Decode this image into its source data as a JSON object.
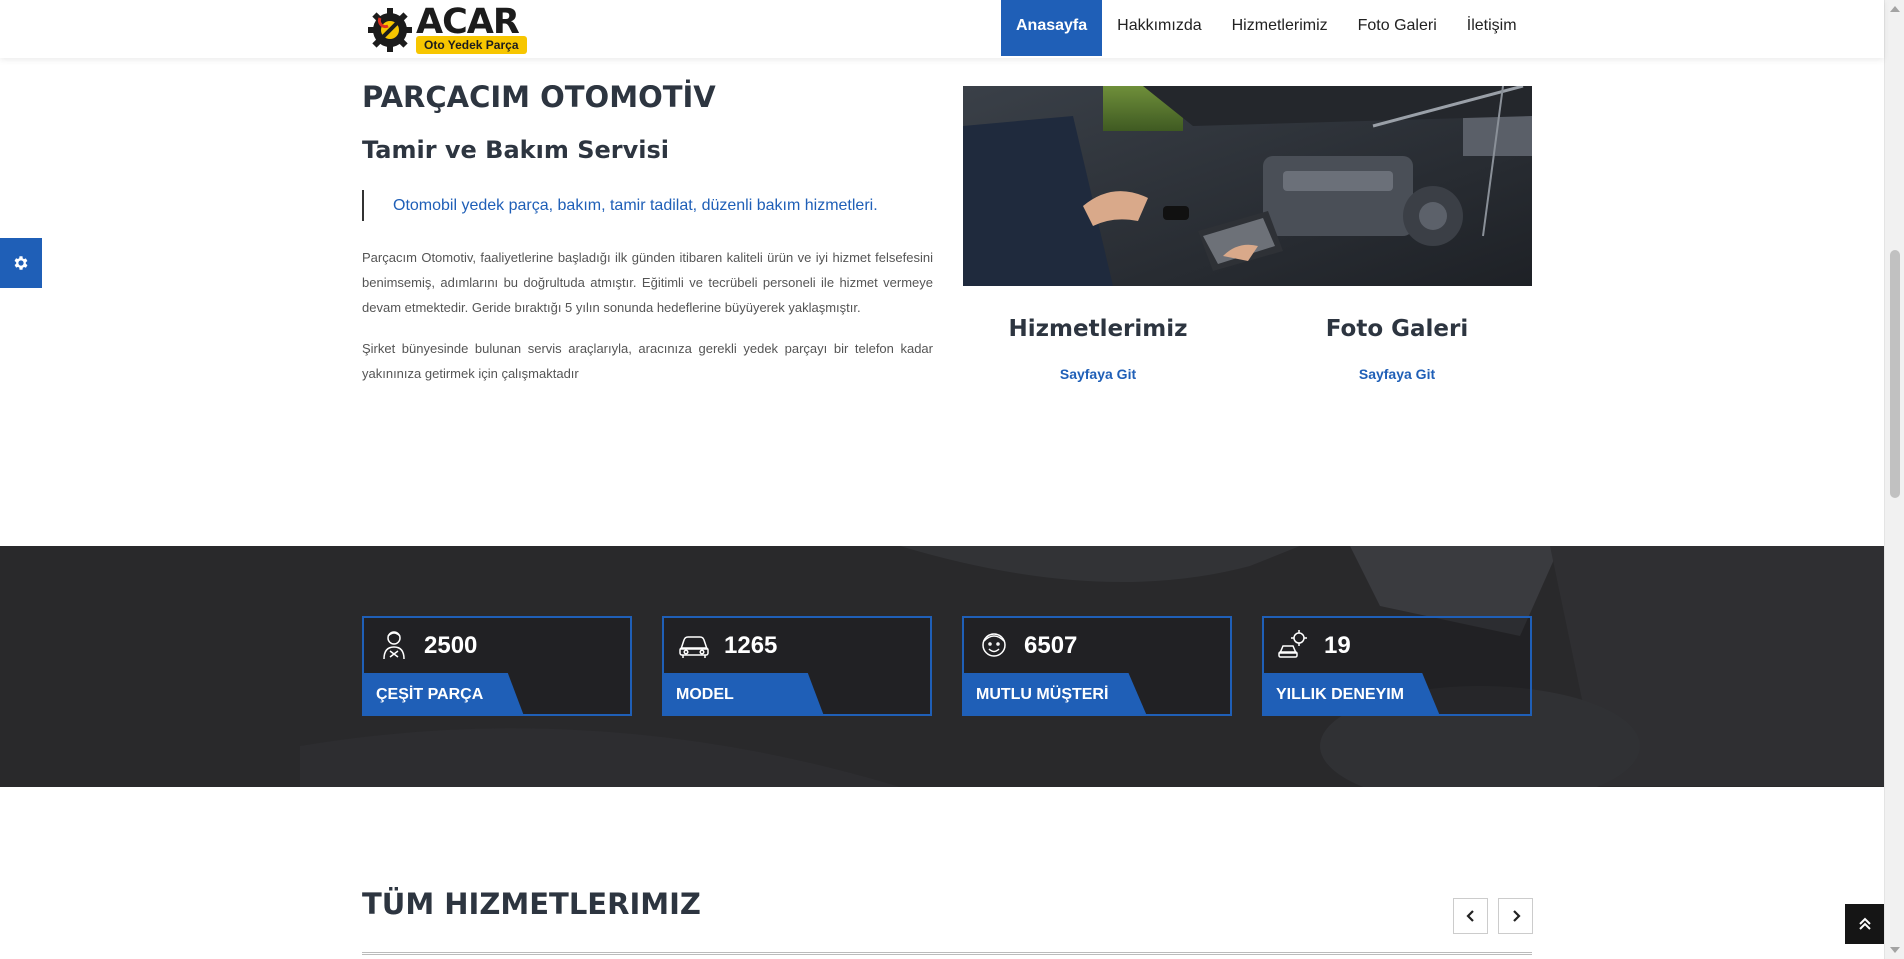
{
  "header": {
    "logo": {
      "brand": "ACAR",
      "tagline": "Oto Yedek Parça"
    },
    "nav": [
      {
        "label": "Anasayfa",
        "active": true
      },
      {
        "label": "Hakkımızda",
        "active": false
      },
      {
        "label": "Hizmetlerimiz",
        "active": false
      },
      {
        "label": "Foto Galeri",
        "active": false
      },
      {
        "label": "İletişim",
        "active": false
      }
    ]
  },
  "intro": {
    "title": "PARÇACIM OTOMOTİV",
    "subtitle": "Tamir ve Bakım Servisi",
    "quote": "Otomobil yedek parça, bakım, tamir tadilat, düzenli bakım hizmetleri.",
    "paragraphs": [
      "Parçacım Otomotiv, faaliyetlerine başladığı ilk günden itibaren kaliteli ürün ve iyi hizmet felsefesini benimsemiş, adımlarını bu doğrultuda atmıştır. Eğitimli ve tecrübeli personeli ile hizmet vermeye devam etmektedir. Geride bıraktığı 5 yılın sonunda hedeflerine büyüyerek yaklaşmıştır.",
      "Şirket bünyesinde bulunan servis araçlarıyla, aracınıza gerekli yedek parçayı bir telefon kadar yakınınıza getirmek için çalışmaktadır"
    ]
  },
  "quick_links": [
    {
      "title": "Hizmetlerimiz",
      "link": "Sayfaya Git"
    },
    {
      "title": "Foto Galeri",
      "link": "Sayfaya Git"
    }
  ],
  "stats": [
    {
      "icon": "mechanic-icon",
      "value": "2500",
      "label": "ÇEŞİT PARÇA"
    },
    {
      "icon": "car-icon",
      "value": "1265",
      "label": "MODEL"
    },
    {
      "icon": "happy-customer-icon",
      "value": "6507",
      "label": "MUTLU MÜŞTERİ"
    },
    {
      "icon": "car-gear-icon",
      "value": "19",
      "label": "YILLIK DENEYIM"
    }
  ],
  "services": {
    "title": "TÜM HIZMETLERIMIZ"
  },
  "colors": {
    "accent": "#1f5fb7",
    "dark_band": "#2a2a2c",
    "logo_yellow": "#f7c600",
    "heading": "#2d3540"
  },
  "icons": {
    "settings": "gear-icon",
    "carousel_prev": "chevron-left-icon",
    "carousel_next": "chevron-right-icon",
    "back_to_top": "double-chevron-up-icon"
  }
}
